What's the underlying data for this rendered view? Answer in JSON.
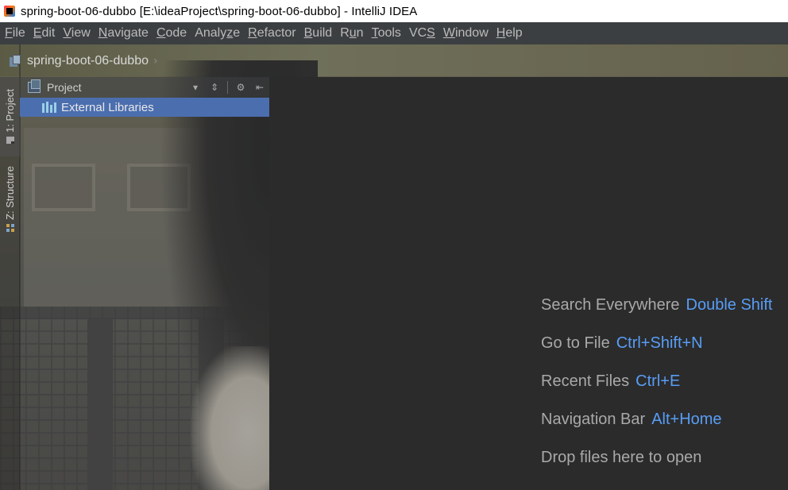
{
  "window": {
    "title": "spring-boot-06-dubbo [E:\\ideaProject\\spring-boot-06-dubbo] - IntelliJ IDEA"
  },
  "menu": {
    "items": [
      {
        "mn": "F",
        "rest": "ile"
      },
      {
        "mn": "E",
        "rest": "dit"
      },
      {
        "mn": "V",
        "rest": "iew"
      },
      {
        "mn": "N",
        "rest": "avigate"
      },
      {
        "mn": "C",
        "rest": "ode"
      },
      {
        "pre": "Analy",
        "mn": "z",
        "rest": "e"
      },
      {
        "mn": "R",
        "rest": "efactor"
      },
      {
        "mn": "B",
        "rest": "uild"
      },
      {
        "pre": "R",
        "mn": "u",
        "rest": "n"
      },
      {
        "mn": "T",
        "rest": "ools"
      },
      {
        "pre": "VC",
        "mn": "S",
        "rest": ""
      },
      {
        "mn": "W",
        "rest": "indow"
      },
      {
        "mn": "H",
        "rest": "elp"
      }
    ]
  },
  "breadcrumb": {
    "project": "spring-boot-06-dubbo"
  },
  "toolstrip": {
    "project_tab": "1: Project",
    "structure_tab": "Z: Structure"
  },
  "project_panel": {
    "header": "Project",
    "tree": [
      {
        "label": "External Libraries",
        "icon": "library-icon",
        "selected": true
      }
    ]
  },
  "editor": {
    "hints": [
      {
        "text": "Search Everywhere",
        "shortcut": "Double Shift"
      },
      {
        "text": "Go to File",
        "shortcut": "Ctrl+Shift+N"
      },
      {
        "text": "Recent Files",
        "shortcut": "Ctrl+E"
      },
      {
        "text": "Navigation Bar",
        "shortcut": "Alt+Home"
      },
      {
        "text": "Drop files here to open",
        "shortcut": ""
      }
    ]
  },
  "colors": {
    "accent_link": "#589df6",
    "selection": "#4b6eaf",
    "editor_bg": "#2b2b2b",
    "menubar_bg": "#3c3f41"
  }
}
